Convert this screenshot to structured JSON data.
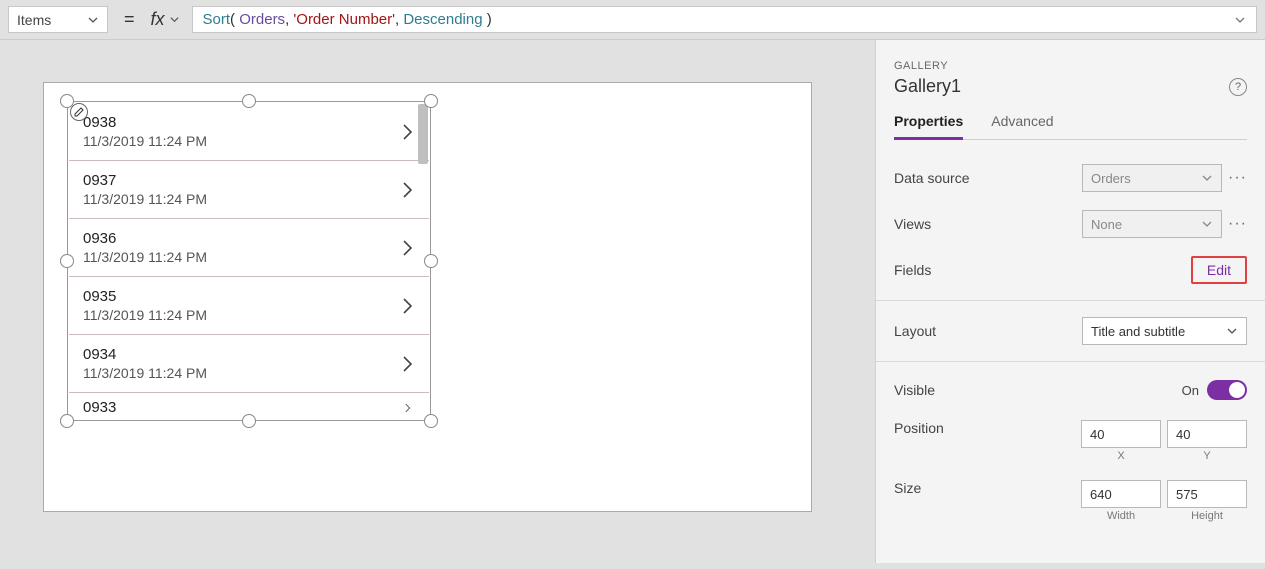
{
  "formulaBar": {
    "property": "Items",
    "equals": "=",
    "fx": "fx",
    "tokens": {
      "fn": "Sort",
      "open": "( ",
      "ds": "Orders",
      "c1": ", ",
      "str": "'Order Number'",
      "c2": ", ",
      "enum": "Descending",
      "close": " )"
    }
  },
  "gallery": {
    "items": [
      {
        "title": "0938",
        "subtitle": "11/3/2019 11:24 PM"
      },
      {
        "title": "0937",
        "subtitle": "11/3/2019 11:24 PM"
      },
      {
        "title": "0936",
        "subtitle": "11/3/2019 11:24 PM"
      },
      {
        "title": "0935",
        "subtitle": "11/3/2019 11:24 PM"
      },
      {
        "title": "0934",
        "subtitle": "11/3/2019 11:24 PM"
      },
      {
        "title": "0933",
        "subtitle": ""
      }
    ]
  },
  "panel": {
    "typeLabel": "GALLERY",
    "name": "Gallery1",
    "help": "?",
    "tabs": {
      "properties": "Properties",
      "advanced": "Advanced"
    },
    "dataSource": {
      "label": "Data source",
      "value": "Orders"
    },
    "views": {
      "label": "Views",
      "value": "None"
    },
    "fields": {
      "label": "Fields",
      "edit": "Edit"
    },
    "layout": {
      "label": "Layout",
      "value": "Title and subtitle"
    },
    "visible": {
      "label": "Visible",
      "state": "On"
    },
    "position": {
      "label": "Position",
      "x": "40",
      "y": "40",
      "xLabel": "X",
      "yLabel": "Y"
    },
    "size": {
      "label": "Size",
      "w": "640",
      "h": "575",
      "wLabel": "Width",
      "hLabel": "Height"
    }
  }
}
